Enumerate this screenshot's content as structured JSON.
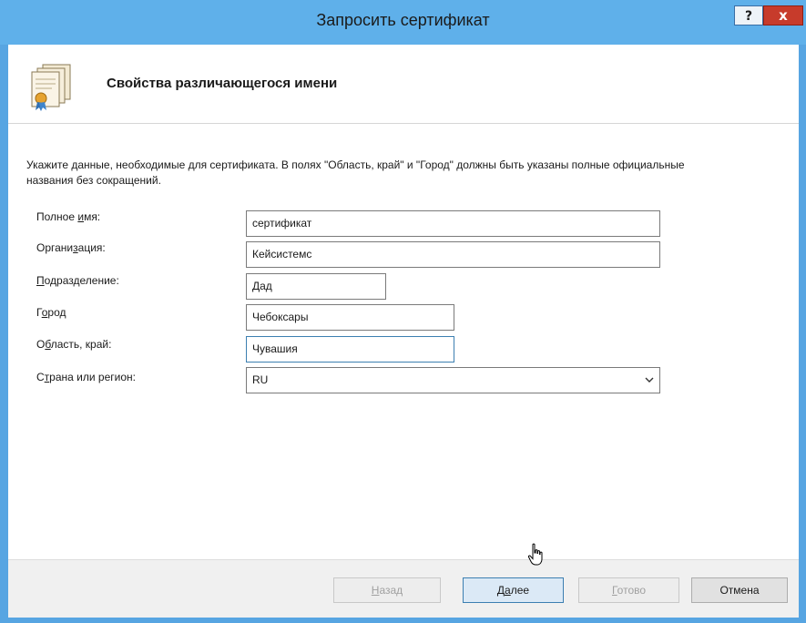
{
  "window": {
    "title": "Запросить сертификат",
    "help_label": "?",
    "close_label": "x"
  },
  "header": {
    "title": "Свойства различающегося имени",
    "icon": "certificate-stack-icon"
  },
  "instructions": "Укажите данные, необходимые для сертификата. В полях \"Область, край\" и \"Город\" должны быть указаны полные официальные названия без сокращений.",
  "fields": [
    {
      "label_pre": "Полное ",
      "label_u": "и",
      "label_post": "мя:",
      "value": "сертификат"
    },
    {
      "label_pre": "Органи",
      "label_u": "з",
      "label_post": "ация:",
      "value": "Кейсистемс"
    },
    {
      "label_pre": "",
      "label_u": "П",
      "label_post": "одразделение:",
      "value": "Дад"
    },
    {
      "label_pre": "Г",
      "label_u": "о",
      "label_post": "род",
      "value": "Чебоксары"
    },
    {
      "label_pre": "О",
      "label_u": "б",
      "label_post": "ласть, край:",
      "value": "Чувашия"
    }
  ],
  "country": {
    "label_pre": "С",
    "label_u": "т",
    "label_post": "рана или регион:",
    "value": "RU"
  },
  "buttons": {
    "back": {
      "u": "Н",
      "rest": "азад"
    },
    "next": {
      "pre": "Д",
      "u": "а",
      "rest": "лее"
    },
    "finish": {
      "u": "Г",
      "rest": "отово"
    },
    "cancel": "Отмена"
  },
  "colors": {
    "titlebar": "#5fb0ea",
    "frame": "#57a5e2",
    "close": "#c73b2b",
    "focus_border": "#3c7fb1"
  }
}
